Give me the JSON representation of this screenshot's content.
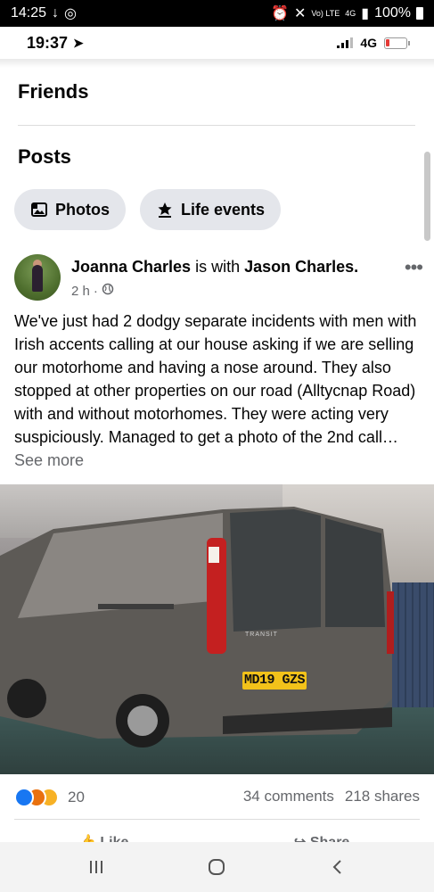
{
  "os_status": {
    "time": "14:25",
    "battery": "100%",
    "network_small_a": "Vo) LTE",
    "network_small_b": "4G"
  },
  "ios_status": {
    "time": "19:37",
    "network": "4G"
  },
  "profile": {
    "friends_title": "Friends",
    "posts_title": "Posts",
    "chips": [
      {
        "label": "Photos",
        "icon": "photo-icon"
      },
      {
        "label": "Life events",
        "icon": "star-flag-icon"
      }
    ]
  },
  "post": {
    "author": "Joanna Charles",
    "with_text": "is with",
    "tagged": "Jason Charles.",
    "time": "2 h",
    "sep": "·",
    "body": "We've just had 2 dodgy separate incidents with men with Irish accents calling at our house asking if we are selling our motorhome and having a nose around. They also stopped at other properties on our road (Alltycnap Road) with and without motorhomes. They were acting very suspiciously. Managed to get a photo of the 2nd call…",
    "see_more": "See more",
    "photo": {
      "plate": "MD19 GZS",
      "van_text": "TRANSIT"
    },
    "reaction_count": "20",
    "comments": "34 comments",
    "shares": "218 shares",
    "like_label": "Like",
    "share_label": "Share"
  },
  "colors": {
    "chip_bg": "#e4e6eb",
    "muted": "#65676b",
    "like_blue": "#1877f2",
    "angry": "#f4a236",
    "love": "#f33e58"
  }
}
